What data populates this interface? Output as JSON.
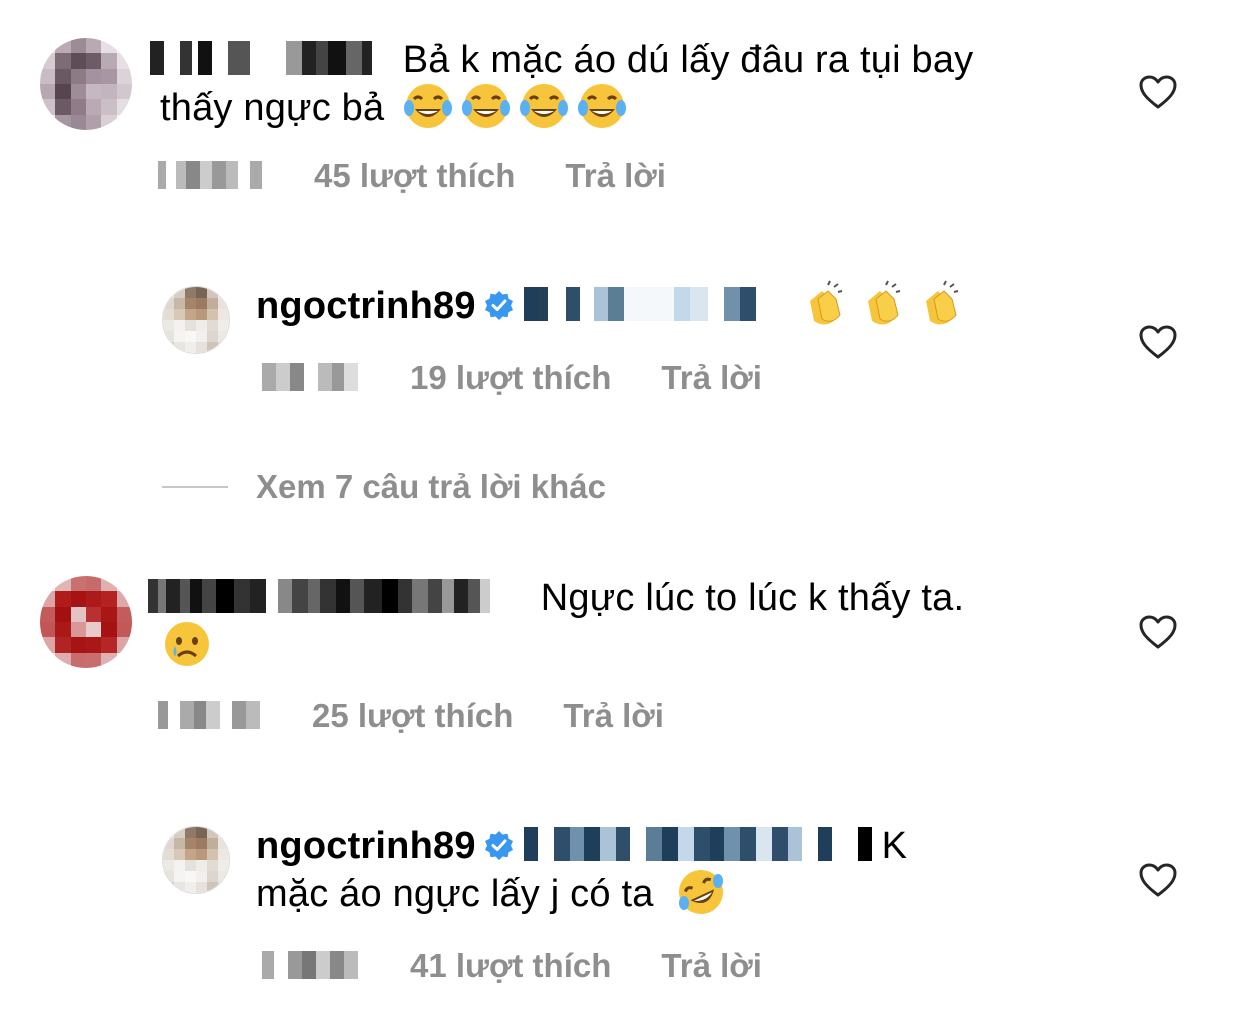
{
  "colors": {
    "text": "#000000",
    "meta": "#8e8e8e",
    "verified": "#3897f0",
    "heart_stroke": "#262626"
  },
  "comments": [
    {
      "id": "c1",
      "avatar": "blurred-avatar",
      "username_redacted": true,
      "text_line1": "Bả k mặc áo dú lấy đâu ra tụi bay",
      "text_line2": "thấy ngực bả",
      "emojis": [
        "😂",
        "😂",
        "😂",
        "😂"
      ],
      "likes": "45 lượt thích",
      "reply": "Trả lời"
    },
    {
      "id": "r1",
      "avatar": "ngoctrinh89-avatar",
      "username": "ngoctrinh89",
      "verified": true,
      "emojis": [
        "👏",
        "👏",
        "👏"
      ],
      "likes": "19 lượt thích",
      "reply": "Trả lời"
    },
    {
      "id": "c2",
      "avatar": "blurred-red-avatar",
      "username_redacted": true,
      "text_line1": "Ngực lúc to lúc k thấy ta.",
      "emojis": [
        "😢"
      ],
      "likes": "25 lượt thích",
      "reply": "Trả lời"
    },
    {
      "id": "r2",
      "avatar": "ngoctrinh89-avatar",
      "username": "ngoctrinh89",
      "verified": true,
      "text_tail": "K",
      "text_line2": "mặc áo ngực lấy j có ta",
      "emojis": [
        "🤣"
      ],
      "likes": "41 lượt thích",
      "reply": "Trả lời"
    }
  ],
  "view_more": "Xem 7 câu trả lời khác"
}
